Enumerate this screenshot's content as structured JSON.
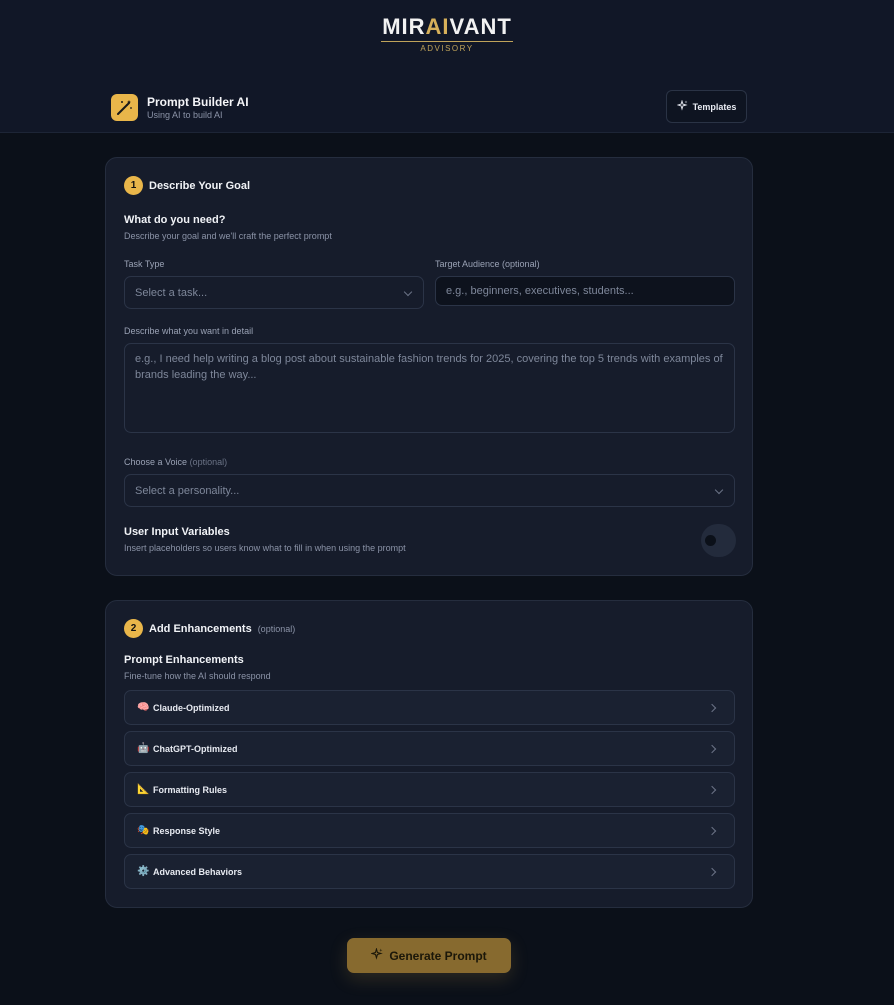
{
  "brand": {
    "name_pre": "MIR",
    "name_ai": "AI",
    "name_post": "VANT",
    "sub": "ADVISORY"
  },
  "header": {
    "title": "Prompt Builder AI",
    "subtitle": "Using AI to build AI",
    "templates_label": "Templates"
  },
  "step1": {
    "number": "1",
    "title": "Describe Your Goal",
    "section_title": "What do you need?",
    "section_desc": "Describe your goal and we'll craft the perfect prompt",
    "task_type_label": "Task Type",
    "task_type_value": "Select a task...",
    "audience_label": "Target Audience (optional)",
    "audience_placeholder": "e.g., beginners, executives, students...",
    "detail_label": "Describe what you want in detail",
    "detail_placeholder": "e.g., I need help writing a blog post about sustainable fashion trends for 2025, covering the top 5 trends with examples of brands leading the way...",
    "voice_label": "Choose a Voice",
    "voice_optional": "(optional)",
    "voice_value": "Select a personality...",
    "variables_title": "User Input Variables",
    "variables_desc": "Insert placeholders so users know what to fill in when using the prompt"
  },
  "step2": {
    "number": "2",
    "title": "Add Enhancements",
    "optional": "(optional)",
    "section_title": "Prompt Enhancements",
    "section_desc": "Fine-tune how the AI should respond",
    "items": [
      {
        "emoji": "🧠",
        "label": "Claude-Optimized"
      },
      {
        "emoji": "🤖",
        "label": "ChatGPT-Optimized"
      },
      {
        "emoji": "📐",
        "label": "Formatting Rules"
      },
      {
        "emoji": "🎭",
        "label": "Response Style"
      },
      {
        "emoji": "⚙️",
        "label": "Advanced Behaviors"
      }
    ]
  },
  "actions": {
    "generate_label": "Generate Prompt"
  },
  "colors": {
    "accent": "#e9b64a",
    "background": "#0b1019",
    "card": "#161c2b"
  }
}
